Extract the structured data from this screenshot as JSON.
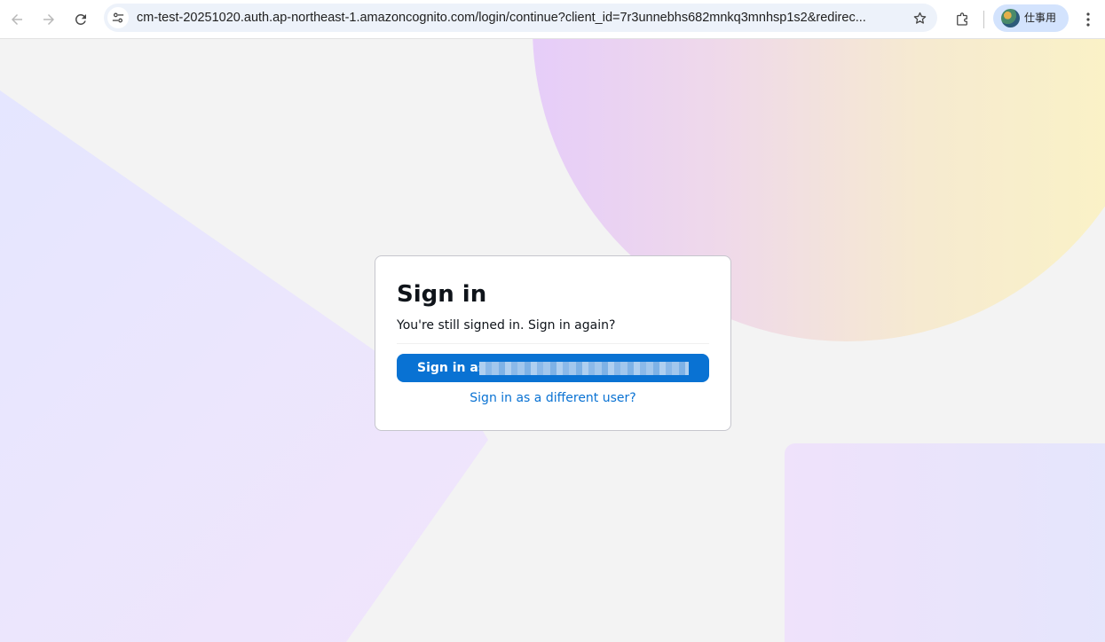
{
  "browser": {
    "url": "cm-test-20251020.auth.ap-northeast-1.amazoncognito.com/login/continue?client_id=7r3unnebhs682mnkq3mnhsp1s2&redirec...",
    "profile_name": "仕事用"
  },
  "signin": {
    "title": "Sign in",
    "message": "You're still signed in. Sign in again?",
    "button_label": "Sign in as",
    "alt_link": "Sign in as a different user?"
  },
  "icons": {
    "back": "back-arrow-icon",
    "forward": "forward-arrow-icon",
    "reload": "reload-icon",
    "site_info": "tune-icon",
    "bookmark": "star-icon",
    "extensions": "puzzle-icon",
    "menu": "more-vert-icon"
  },
  "colors": {
    "primary_button": "#0972d3",
    "link": "#0972d3",
    "omnibox": "#edf2fa",
    "profile_chip": "#d3e3fd"
  }
}
